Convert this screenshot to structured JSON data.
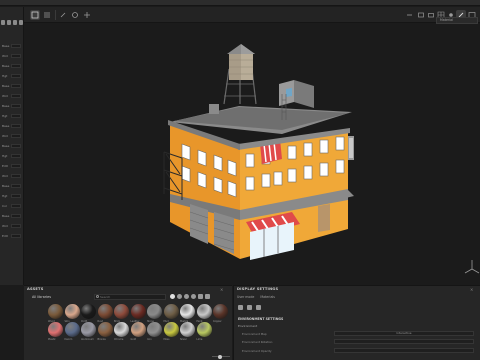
{
  "assets": {
    "title": "ASSETS",
    "filter_label": "All libraries",
    "search_placeholder": "Search",
    "materials": [
      {
        "name": "Wood",
        "color": "#7a5a3a"
      },
      {
        "name": "Skin",
        "color": "#d9a78c"
      },
      {
        "name": "Cloth",
        "color": "#1a1a1a"
      },
      {
        "name": "Rust",
        "color": "#7b4a33"
      },
      {
        "name": "Brick",
        "color": "#8e4a3a"
      },
      {
        "name": "Leather",
        "color": "#6a2a22"
      },
      {
        "name": "Stone",
        "color": "#8a8a8a"
      },
      {
        "name": "Mud",
        "color": "#6e5d45"
      },
      {
        "name": "Marble",
        "color": "#e6e6e6"
      },
      {
        "name": "Paint",
        "color": "#c8c8c8"
      },
      {
        "name": "Copper",
        "color": "#5a3428"
      },
      {
        "name": "Plastic",
        "color": "#e07070"
      },
      {
        "name": "Denim",
        "color": "#5a6a8a"
      },
      {
        "name": "Aluminium",
        "color": "#9a9aa5"
      },
      {
        "name": "Bronze",
        "color": "#8a6040"
      },
      {
        "name": "Chrome",
        "color": "#d8d8d8"
      },
      {
        "name": "Gold",
        "color": "#d0a080"
      },
      {
        "name": "Iron",
        "color": "#909090"
      },
      {
        "name": "Moss",
        "color": "#c8c840"
      },
      {
        "name": "Silver",
        "color": "#cfcfcf"
      },
      {
        "name": "Lime",
        "color": "#b8c860"
      }
    ]
  },
  "display": {
    "title": "DISPLAY SETTINGS",
    "tabs": [
      "User mode",
      "Materials"
    ],
    "section": "ENVIRONMENT SETTINGS",
    "subsection": "Environment",
    "field1_label": "Environment Map",
    "field1_value": "Interactive",
    "field2_label": "Environment Rotation",
    "field3_label": "Environment Opacity"
  },
  "viewport": {
    "mode": "Material"
  },
  "left_panel": {
    "rows": [
      "Base",
      "Wid",
      "Base",
      "Hgt",
      "Base",
      "Wid",
      "Base",
      "Hgt",
      "Base",
      "Wid",
      "Base",
      "Hgt",
      "Edit",
      "Wid",
      "Base",
      "Hgt",
      "Col",
      "Base",
      "Wid",
      "Edit"
    ]
  }
}
